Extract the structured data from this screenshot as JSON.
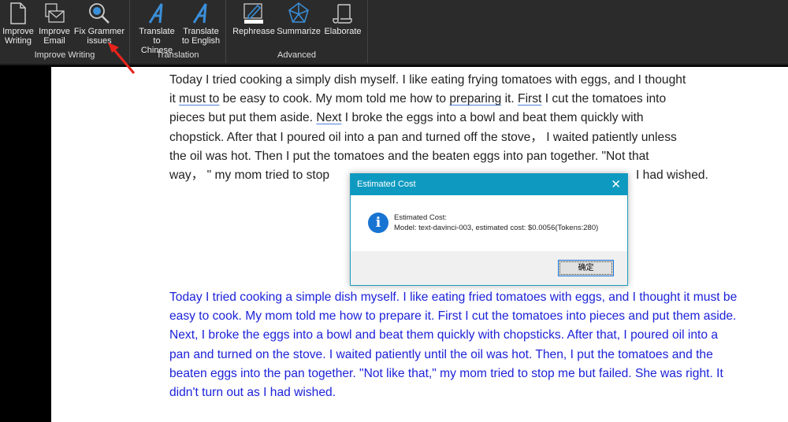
{
  "toolbar": {
    "groups": [
      {
        "label": "Improve Writing",
        "buttons": [
          {
            "l1": "Improve",
            "l2": "Writing",
            "icon": "document-icon"
          },
          {
            "l1": "Improve",
            "l2": "Email",
            "icon": "email-icon"
          },
          {
            "l1": "Fix Grammer",
            "l2": "issues",
            "icon": "magnifier-icon"
          }
        ]
      },
      {
        "label": "Translation",
        "buttons": [
          {
            "l1": "Translate",
            "l2": "to Chinese",
            "icon": "translate-icon"
          },
          {
            "l1": "Translate",
            "l2": "to English",
            "icon": "translate-icon"
          }
        ]
      },
      {
        "label": "Advanced",
        "buttons": [
          {
            "l1": "Rephrease",
            "icon": "pencil-icon"
          },
          {
            "l1": "Summarize",
            "icon": "radar-icon"
          },
          {
            "l1": "Elaborate",
            "icon": "scroll-icon"
          }
        ]
      }
    ],
    "accent": "#3a8fd8"
  },
  "document": {
    "original": {
      "line1": "Today I tried cooking a simply dish myself. I like eating frying tomatoes with eggs, and I thought",
      "line2": [
        "it ",
        "must to",
        " be easy to cook. My mom told me how to ",
        "preparing",
        " it. ",
        "First",
        " I cut the tomatoes into"
      ],
      "line3": [
        "pieces but put them aside. ",
        "Next",
        " I broke the eggs into a bowl and beat them quickly with"
      ],
      "line4": "chopstick. After that I poured oil into a pan and turned off the stove，   I waited patiently unless",
      "line5": "the oil was hot. Then I put the tomatoes and the beaten eggs into pan together. \"Not that",
      "line6_left": "way，  \" my mom tried to stop",
      "line6_right": "I had wished."
    },
    "corrected": "Today I tried cooking a simple dish myself. I like eating fried tomatoes with eggs, and I thought it must be easy to cook. My mom told me how to prepare it. First I cut the tomatoes into pieces and put them aside. Next, I broke the eggs into a bowl and beat them quickly with chopsticks. After that, I poured oil into a pan and turned on the stove. I waited patiently until the oil was hot. Then, I put the tomatoes and the beaten eggs into the pan together. \"Not like that,\" my mom tried to stop me but failed. She was right. It didn't turn out as I had wished.",
    "corrected_color": "#1c22d8"
  },
  "dialog": {
    "title": "Estimated Cost",
    "heading": "Estimated Cost:",
    "message": "Model: text-davinci-003, estimated cost: $0.0056(Tokens:280)",
    "ok_label": "确定",
    "close_icon": "✕",
    "info_icon": "i",
    "title_color": "#0e9ac0"
  }
}
